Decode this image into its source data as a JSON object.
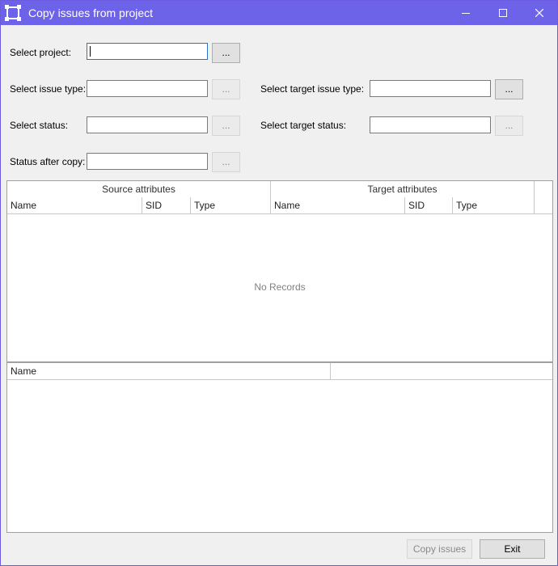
{
  "window": {
    "title": "Copy issues from project",
    "controls": [
      "minimize-icon",
      "maximize-icon",
      "close-icon"
    ],
    "accent": "#6c63e9"
  },
  "form": {
    "project_label": "Select project:",
    "project_value": "",
    "issue_type_label": "Select issue type:",
    "issue_type_value": "",
    "status_label": "Select status:",
    "status_value": "",
    "status_after_label": "Status after copy:",
    "status_after_value": "",
    "target_issue_type_label": "Select target issue type:",
    "target_issue_type_value": "",
    "target_status_label": "Select target status:",
    "target_status_value": "",
    "browse_label": "..."
  },
  "mapping_grid": {
    "bands": [
      "Source attributes",
      "Target attributes"
    ],
    "columns": [
      "Name",
      "SID",
      "Type",
      "Name",
      "SID",
      "Type"
    ],
    "empty_text": "No Records"
  },
  "lower_grid": {
    "columns": [
      "Name",
      ""
    ]
  },
  "footer": {
    "copy_label": "Copy issues",
    "exit_label": "Exit"
  }
}
